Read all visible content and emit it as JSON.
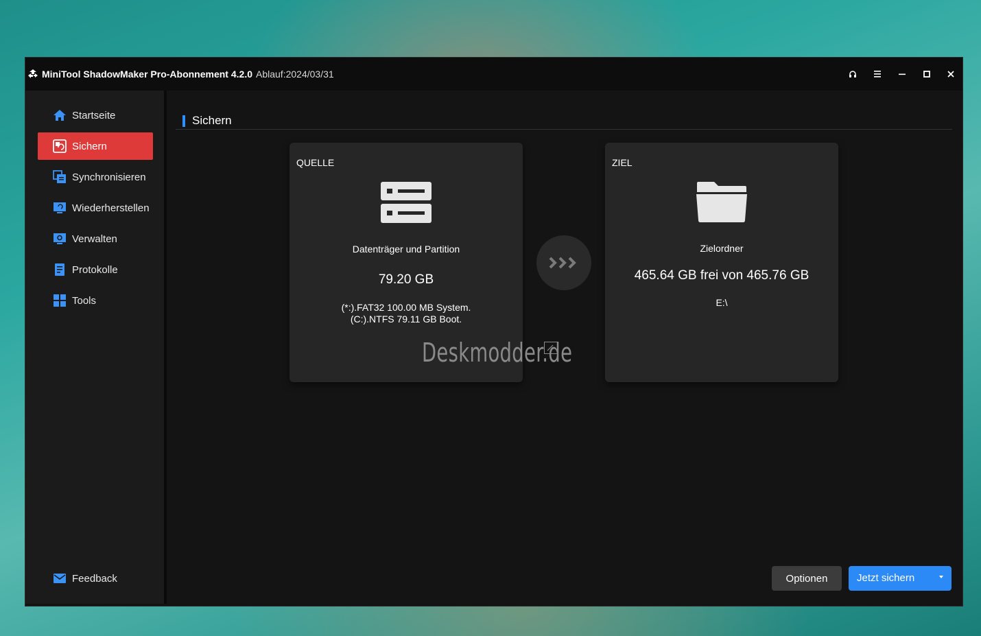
{
  "window": {
    "title": "MiniTool ShadowMaker Pro-Abonnement 4.2.0",
    "subscription": "Ablauf:2024/03/31"
  },
  "sidebar": {
    "items": [
      {
        "label": "Startseite",
        "icon": "home-icon"
      },
      {
        "label": "Sichern",
        "icon": "backup-icon",
        "active": true
      },
      {
        "label": "Synchronisieren",
        "icon": "sync-icon"
      },
      {
        "label": "Wiederherstellen",
        "icon": "restore-icon"
      },
      {
        "label": "Verwalten",
        "icon": "manage-icon"
      },
      {
        "label": "Protokolle",
        "icon": "logs-icon"
      },
      {
        "label": "Tools",
        "icon": "tools-icon"
      }
    ],
    "feedback": {
      "label": "Feedback",
      "icon": "mail-icon"
    }
  },
  "main": {
    "section_title": "Sichern",
    "source": {
      "label": "QUELLE",
      "title": "Datenträger und Partition",
      "size": "79.20 GB",
      "line1": "(*:).FAT32 100.00 MB System.",
      "line2": "(C:).NTFS 79.11 GB Boot."
    },
    "destination": {
      "label": "ZIEL",
      "title": "Zielordner",
      "space": "465.64 GB frei von 465.76 GB",
      "path": "E:\\"
    },
    "watermark": "Deskmodder.de",
    "options_label": "Optionen",
    "backup_label": "Jetzt sichern"
  },
  "colors": {
    "accent_red": "#de3a3a",
    "accent_blue": "#2b8af5",
    "icon_blue": "#3a93f5"
  }
}
